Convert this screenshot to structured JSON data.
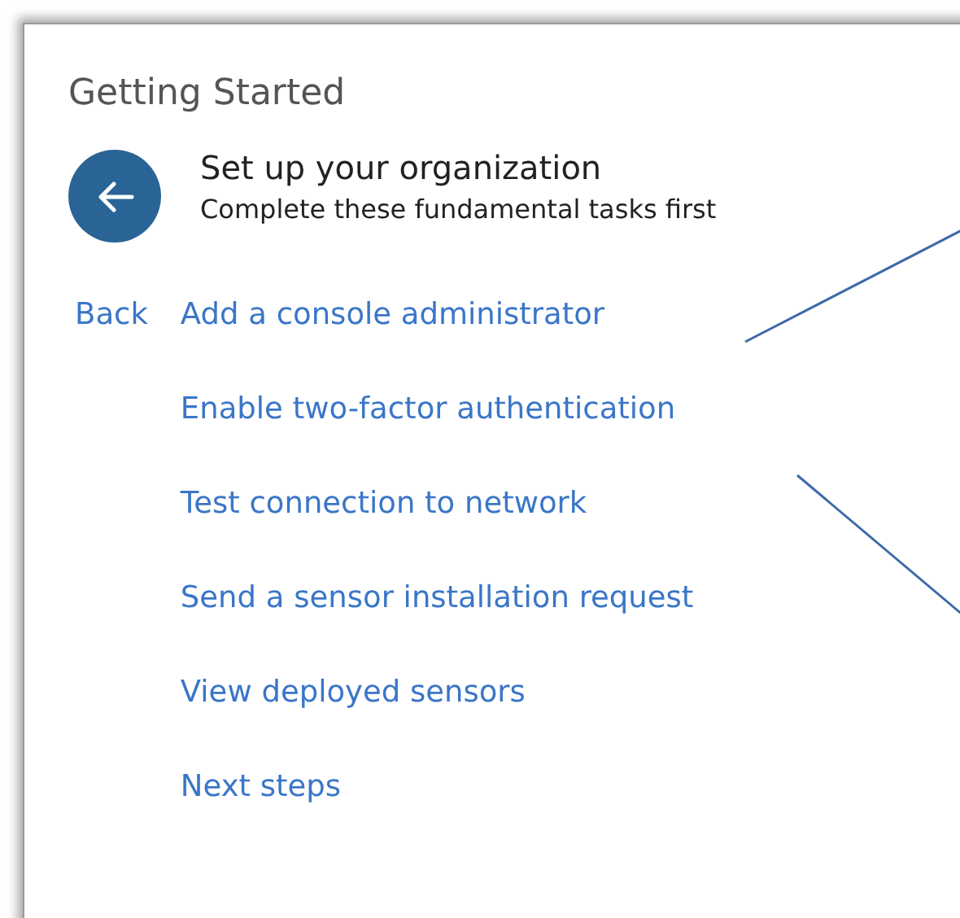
{
  "panel": {
    "title": "Getting Started"
  },
  "header": {
    "title": "Set up your organization",
    "subtitle": "Complete these fundamental tasks first"
  },
  "back_link": "Back",
  "tasks": [
    "Add a console administrator",
    "Enable two-factor authentication",
    "Test connection to network",
    "Send a sensor installation request",
    "View deployed sensors",
    "Next steps"
  ]
}
